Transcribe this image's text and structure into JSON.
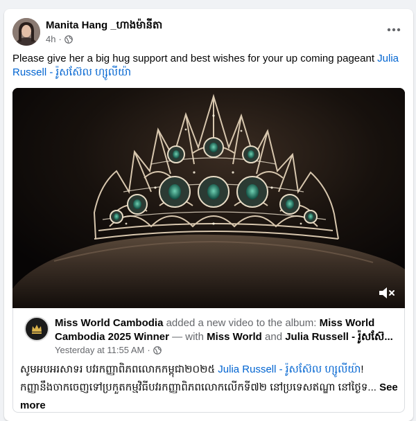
{
  "post": {
    "author": "Manita Hang _ហាងម៉ានីតា",
    "time": "4h",
    "time_separator": "·",
    "text": "Please give her a big hug support and best wishes for your up coming pageant ",
    "mention": "Julia Russell - រ៉ូសស៊ែល ហ្សូលីយ៉ា",
    "icons": {
      "privacy": "globe-icon",
      "more": "more-dots-icon",
      "mute": "speaker-muted-icon"
    }
  },
  "attachment": {
    "page_name": "Miss World Cambodia",
    "action": " added a new video to the album: ",
    "album": "Miss World Cambodia 2025 Winner",
    "with_text": " — with ",
    "tag1": "Miss World",
    "and_text": " and ",
    "tag2": "Julia Russell - រ៉ូសស៊ែ...",
    "time": "Yesterday at 11:55 AM",
    "time_separator": "·",
    "body_prefix": "សូមអបអរសាទរ បវរកញ្ញាពិភពលោកកម្ពុជា២០២៥ ",
    "body_mention": "Julia Russell - រ៉ូសស៊ែល ហ្សូលីយ៉ា",
    "body_excl": "!",
    "body_rest": "កញ្ញានឹងចាកចេញទៅប្រកួតកម្មវិធីបវរកញ្ញាពិភពលោកលើកទី៧២ នៅប្រទេសឥណ្ឌា នៅថ្ងៃទ... ",
    "see_more": "See more"
  },
  "colors": {
    "link": "#0064d1",
    "secondary": "#65676b",
    "card": "#ffffff",
    "background": "#f0f2f5"
  }
}
